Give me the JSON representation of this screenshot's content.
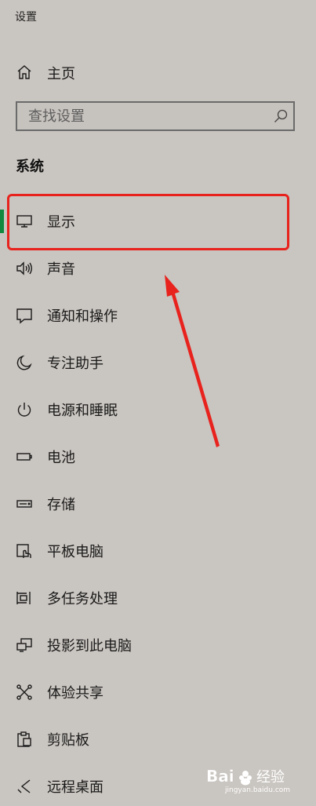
{
  "window": {
    "title": "设置"
  },
  "home": {
    "icon": "home-icon",
    "label": "主页"
  },
  "search": {
    "placeholder": "查找设置",
    "value": ""
  },
  "section": {
    "heading": "系统"
  },
  "nav_items": [
    {
      "icon": "monitor-icon",
      "label": "显示",
      "selected": true
    },
    {
      "icon": "speaker-icon",
      "label": "声音",
      "selected": false
    },
    {
      "icon": "notification-icon",
      "label": "通知和操作",
      "selected": false
    },
    {
      "icon": "moon-icon",
      "label": "专注助手",
      "selected": false
    },
    {
      "icon": "power-icon",
      "label": "电源和睡眠",
      "selected": false
    },
    {
      "icon": "battery-icon",
      "label": "电池",
      "selected": false
    },
    {
      "icon": "storage-icon",
      "label": "存储",
      "selected": false
    },
    {
      "icon": "tablet-icon",
      "label": "平板电脑",
      "selected": false
    },
    {
      "icon": "multitask-icon",
      "label": "多任务处理",
      "selected": false
    },
    {
      "icon": "project-icon",
      "label": "投影到此电脑",
      "selected": false
    },
    {
      "icon": "share-icon",
      "label": "体验共享",
      "selected": false
    },
    {
      "icon": "clipboard-icon",
      "label": "剪贴板",
      "selected": false
    },
    {
      "icon": "remote-desktop-icon",
      "label": "远程桌面",
      "selected": false
    }
  ],
  "annotation": {
    "color": "#e8221d"
  },
  "colors": {
    "background": "#c9c5c0",
    "selection_accent": "#10893e"
  },
  "watermark": {
    "logo_text": "Bai 经验",
    "subtext": "jingyan.baidu.com"
  }
}
